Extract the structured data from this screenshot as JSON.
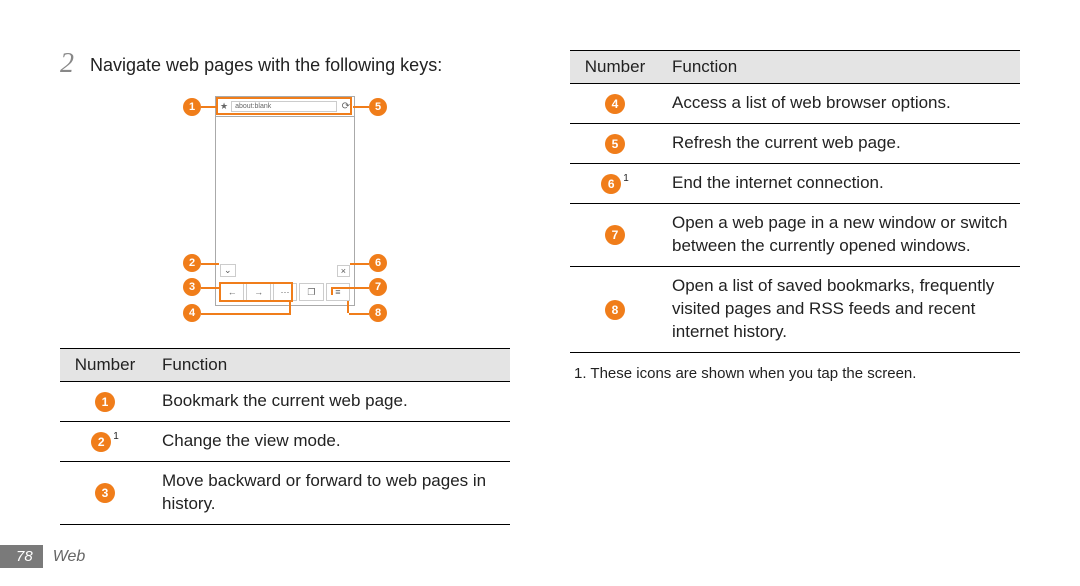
{
  "step": {
    "number": "2",
    "text": "Navigate web pages with the following keys:"
  },
  "diagram": {
    "url_text": "about:blank",
    "callouts": [
      "1",
      "2",
      "3",
      "4",
      "5",
      "6",
      "7",
      "8"
    ]
  },
  "table_left": {
    "head_number": "Number",
    "head_function": "Function",
    "rows": [
      {
        "num": "1",
        "sup": "",
        "text": "Bookmark the current web page."
      },
      {
        "num": "2",
        "sup": "1",
        "text": "Change the view mode."
      },
      {
        "num": "3",
        "sup": "",
        "text": "Move backward or forward to web pages in history."
      }
    ]
  },
  "table_right": {
    "head_number": "Number",
    "head_function": "Function",
    "rows": [
      {
        "num": "4",
        "sup": "",
        "text": "Access a list of web browser options."
      },
      {
        "num": "5",
        "sup": "",
        "text": "Refresh the current web page."
      },
      {
        "num": "6",
        "sup": "1",
        "text": "End the internet connection."
      },
      {
        "num": "7",
        "sup": "",
        "text": "Open a web page in a new window or switch between the currently opened windows."
      },
      {
        "num": "8",
        "sup": "",
        "text": "Open a list of saved bookmarks, frequently visited pages and RSS feeds and recent internet history."
      }
    ]
  },
  "footnote": "1. These icons are shown when you tap the screen.",
  "footer": {
    "page": "78",
    "section": "Web"
  }
}
